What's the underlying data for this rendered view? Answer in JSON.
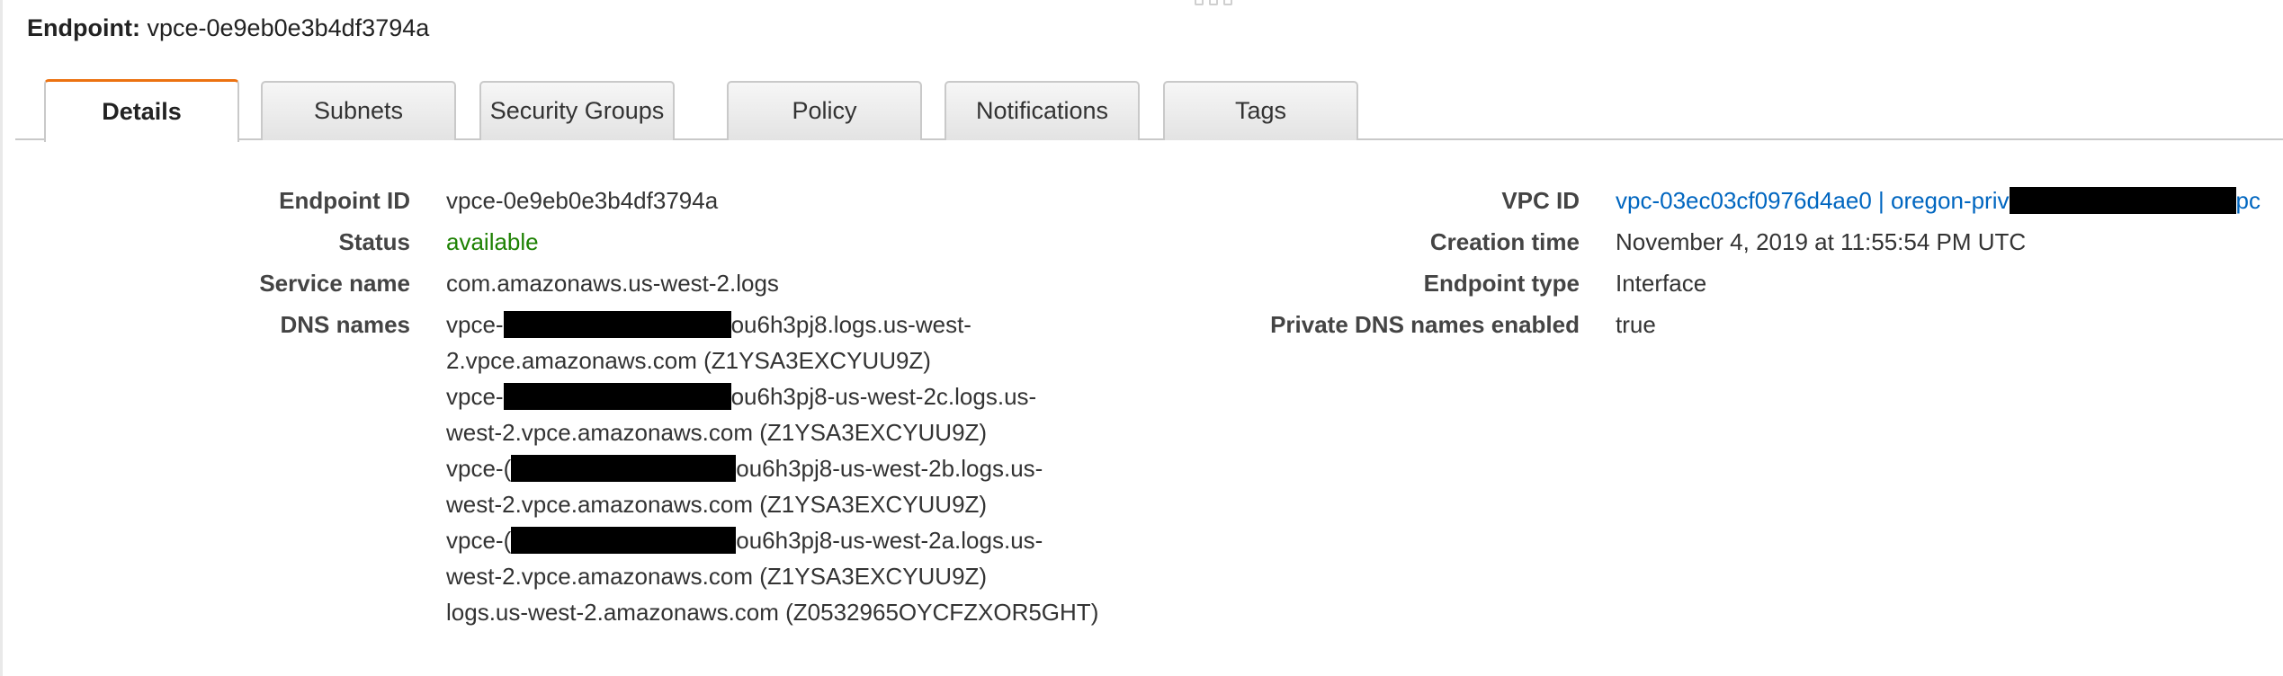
{
  "header": {
    "label": "Endpoint:",
    "value": "vpce-0e9eb0e3b4df3794a"
  },
  "tabs": [
    {
      "label": "Details",
      "active": true
    },
    {
      "label": "Subnets"
    },
    {
      "label": "Security Groups"
    },
    {
      "label": "Policy"
    },
    {
      "label": "Notifications"
    },
    {
      "label": "Tags"
    }
  ],
  "details": {
    "endpoint_id": {
      "label": "Endpoint ID",
      "value": "vpce-0e9eb0e3b4df3794a"
    },
    "status": {
      "label": "Status",
      "value": "available"
    },
    "service_name": {
      "label": "Service name",
      "value": "com.amazonaws.us-west-2.logs"
    },
    "dns_names": {
      "label": "DNS names",
      "lines": [
        {
          "pre": "vpce-",
          "post": "ou6h3pj8.logs.us-west-"
        },
        {
          "text": "2.vpce.amazonaws.com (Z1YSA3EXCYUU9Z)"
        },
        {
          "pre": "vpce-",
          "post": "ou6h3pj8-us-west-2c.logs.us-"
        },
        {
          "text": "west-2.vpce.amazonaws.com (Z1YSA3EXCYUU9Z)"
        },
        {
          "pre": "vpce-(",
          "post": "ou6h3pj8-us-west-2b.logs.us-"
        },
        {
          "text": "west-2.vpce.amazonaws.com (Z1YSA3EXCYUU9Z)"
        },
        {
          "pre": "vpce-(",
          "post": "ou6h3pj8-us-west-2a.logs.us-"
        },
        {
          "text": "west-2.vpce.amazonaws.com (Z1YSA3EXCYUU9Z)"
        },
        {
          "text": "logs.us-west-2.amazonaws.com (Z0532965OYCFZXOR5GHT)"
        }
      ]
    },
    "vpc_id": {
      "label": "VPC ID",
      "pre": "vpc-03ec03cf0976d4ae0 | oregon-priv",
      "post": "pc"
    },
    "creation_time": {
      "label": "Creation time",
      "value": "November 4, 2019 at 11:55:54 PM UTC"
    },
    "endpoint_type": {
      "label": "Endpoint type",
      "value": "Interface"
    },
    "private_dns": {
      "label": "Private DNS names enabled",
      "value": "true"
    }
  },
  "colors": {
    "active_tab_accent": "#ec7211",
    "status_available": "#1d8102",
    "link": "#0066c0",
    "redaction": "#000000"
  }
}
